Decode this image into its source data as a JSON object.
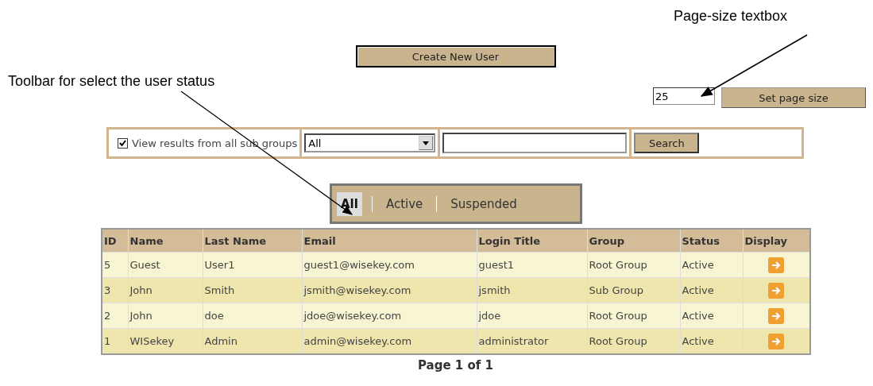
{
  "annotations": [
    {
      "text": "Page-size textbox",
      "kind": "right"
    },
    {
      "text": "Toolbar for select the user status",
      "kind": "left"
    }
  ],
  "create_button": "Create New User",
  "page_size": {
    "value": "25",
    "button": "Set page size"
  },
  "filter": {
    "checkbox": {
      "label": "View results from all sub groups",
      "checked": true
    },
    "group_select": "All",
    "search_button": "Search"
  },
  "status_tabs": [
    {
      "label": "All",
      "selected": true
    },
    {
      "label": "Active",
      "selected": false
    },
    {
      "label": "Suspended",
      "selected": false
    }
  ],
  "table": {
    "columns": [
      "ID",
      "Name",
      "Last Name",
      "Email",
      "Login Title",
      "Group",
      "Status",
      "Display"
    ],
    "rows": [
      [
        "5",
        "Guest",
        "User1",
        "guest1@wisekey.com",
        "guest1",
        "Root Group",
        "Active"
      ],
      [
        "3",
        "John",
        "Smith",
        "jsmith@wisekey.com",
        "jsmith",
        "Sub Group",
        "Active"
      ],
      [
        "2",
        "John",
        "doe",
        "jdoe@wisekey.com",
        "jdoe",
        "Root Group",
        "Active"
      ],
      [
        "1",
        "WISekey",
        "Admin",
        "admin@wisekey.com",
        "administrator",
        "Root Group",
        "Active"
      ]
    ]
  },
  "pagination": "Page 1 of 1"
}
